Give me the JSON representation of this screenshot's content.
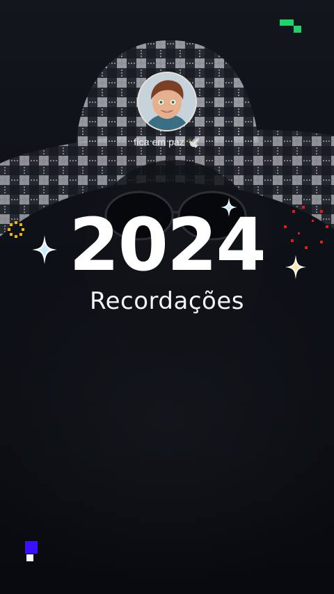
{
  "profile": {
    "caption": "fica em paz",
    "caption_emoji": "🕊️",
    "avatar_icon": "cartoon-avatar-icon"
  },
  "title": {
    "year": "2024",
    "subtitle": "Recordações"
  },
  "decorations": {
    "sparkle_color": "#ffffff",
    "sparkle_glow": "#7fd3ff",
    "gold_ring_color": "#f2b705",
    "red_dots_color": "#e01b1b",
    "green_pixels_color": "#1fd36b",
    "purple_pixel_color": "#3b10ff"
  }
}
